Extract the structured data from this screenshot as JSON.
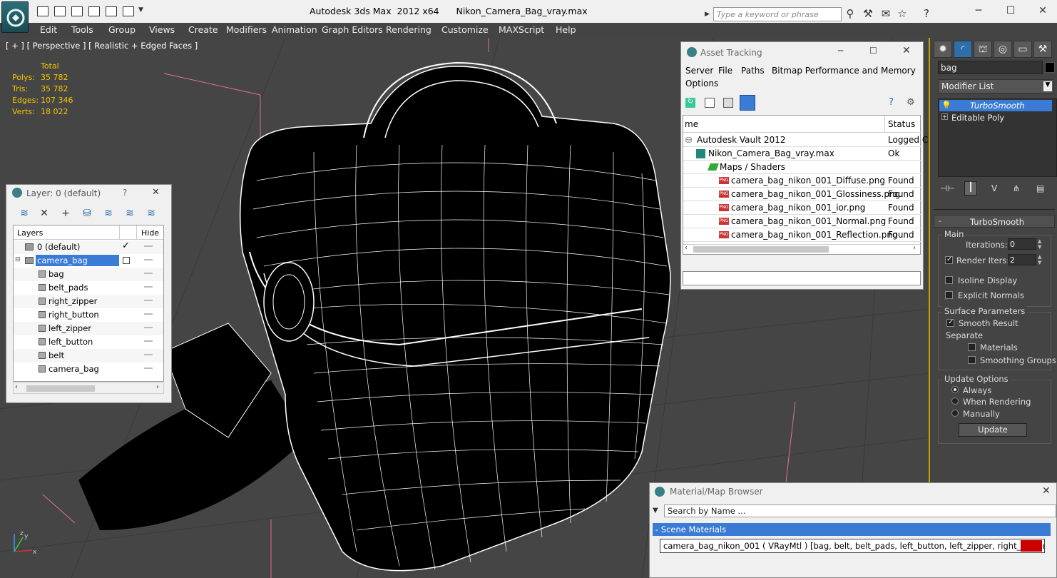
{
  "app": {
    "window_title": "Autodesk 3ds Max  2012 x64      Nikon_Camera_Bag_vray.max",
    "search_placeholder": "Type a keyword or phrase"
  },
  "menu": [
    "Edit",
    "Tools",
    "Group",
    "Views",
    "Create",
    "Modifiers",
    "Animation",
    "Graph Editors",
    "Rendering",
    "Customize",
    "MAXScript",
    "Help"
  ],
  "viewport": {
    "label": "[ + ] [ Perspective ] [ Realistic + Edged Faces ]",
    "stats": {
      "header": "Total",
      "rows": [
        {
          "label": "Polys:",
          "value": "35 782"
        },
        {
          "label": "Tris:",
          "value": "35 782"
        },
        {
          "label": "Edges:",
          "value": "107 346"
        },
        {
          "label": "Verts:",
          "value": "18 022"
        }
      ]
    },
    "axis": {
      "x": "x",
      "y": "y",
      "z": "z"
    }
  },
  "layer_panel": {
    "title": "Layer: 0 (default)",
    "help": "?",
    "close": "✕",
    "col_layers": "Layers",
    "col_hide": "Hide",
    "rows": [
      {
        "label": "0 (default)",
        "indent": 0,
        "checked": true
      },
      {
        "label": "camera_bag",
        "indent": 0,
        "selected": true
      },
      {
        "label": "bag",
        "indent": 1
      },
      {
        "label": "belt_pads",
        "indent": 1
      },
      {
        "label": "right_zipper",
        "indent": 1
      },
      {
        "label": "right_button",
        "indent": 1
      },
      {
        "label": "left_zipper",
        "indent": 1
      },
      {
        "label": "left_button",
        "indent": 1
      },
      {
        "label": "belt",
        "indent": 1
      },
      {
        "label": "camera_bag",
        "indent": 1
      }
    ]
  },
  "asset_panel": {
    "title": "Asset Tracking",
    "menu": [
      "Server",
      "File",
      "Paths",
      "Bitmap Performance and Memory"
    ],
    "menu2": "Options",
    "col_name": "me",
    "col_status": "Status",
    "rows": [
      {
        "name": "Autodesk Vault 2012",
        "status": "Logged C",
        "indent": 0
      },
      {
        "name": "Nikon_Camera_Bag_vray.max",
        "status": "Ok",
        "indent": 1
      },
      {
        "name": "Maps / Shaders",
        "status": "",
        "indent": 2
      },
      {
        "name": "camera_bag_nikon_001_Diffuse.png",
        "status": "Found",
        "indent": 3
      },
      {
        "name": "camera_bag_nikon_001_Glossiness.png",
        "status": "Found",
        "indent": 3
      },
      {
        "name": "camera_bag_nikon_001_ior.png",
        "status": "Found",
        "indent": 3
      },
      {
        "name": "camera_bag_nikon_001_Normal.png",
        "status": "Found",
        "indent": 3
      },
      {
        "name": "camera_bag_nikon_001_Reflection.png",
        "status": "Found",
        "indent": 3
      }
    ]
  },
  "command_panel": {
    "object_name": "bag",
    "modifier_list": "Modifier List",
    "stack": [
      "TurboSmooth",
      "Editable Poly"
    ],
    "rollout_title": "TurboSmooth",
    "main_label": "Main",
    "iterations_label": "Iterations:",
    "iterations_value": "0",
    "render_iters_label": "Render Iters:",
    "render_iters_value": "2",
    "isoline_label": "Isoline Display",
    "explicit_label": "Explicit Normals",
    "surface_label": "Surface Parameters",
    "smooth_result_label": "Smooth Result",
    "separate_label": "Separate",
    "materials_label": "Materials",
    "smoothing_groups_label": "Smoothing Groups",
    "update_options_label": "Update Options",
    "always_label": "Always",
    "when_rendering_label": "When Rendering",
    "manually_label": "Manually",
    "update_button": "Update"
  },
  "material_browser": {
    "title": "Material/Map Browser",
    "search_placeholder": "Search by Name ...",
    "section": "- Scene Materials",
    "item": "camera_bag_nikon_001 ( VRayMtl ) [bag, belt, belt_pads, left_button, left_zipper, right_button, right_..."
  }
}
